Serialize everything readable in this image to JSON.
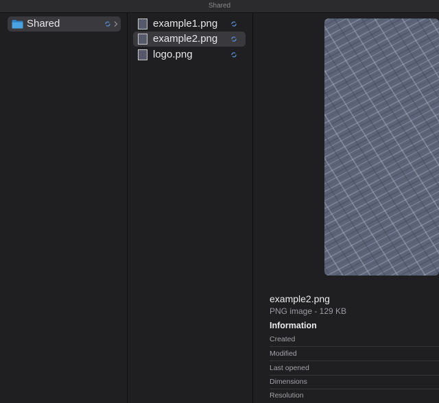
{
  "window": {
    "title": "Shared"
  },
  "sidebar": {
    "items": [
      {
        "label": "Shared",
        "icon": "folder-icon",
        "status_icon": "sync-icon"
      }
    ]
  },
  "files": {
    "items": [
      {
        "label": "example1.png",
        "icon": "image-file-icon",
        "status_icon": "sync-icon"
      },
      {
        "label": "example2.png",
        "icon": "image-file-icon",
        "status_icon": "sync-icon"
      },
      {
        "label": "logo.png",
        "icon": "image-file-icon",
        "status_icon": "sync-icon"
      }
    ],
    "selected": "example2.png"
  },
  "preview": {
    "name": "example2.png",
    "kind": "PNG image - 129 KB",
    "information_heading": "Information",
    "fields": [
      {
        "label": "Created"
      },
      {
        "label": "Modified"
      },
      {
        "label": "Last opened"
      },
      {
        "label": "Dimensions"
      },
      {
        "label": "Resolution"
      }
    ]
  },
  "colors": {
    "accent": "#5b8fd9",
    "folder": "#4aa3e0",
    "selection": "#3a3a3e",
    "background": "#1f1f22"
  }
}
